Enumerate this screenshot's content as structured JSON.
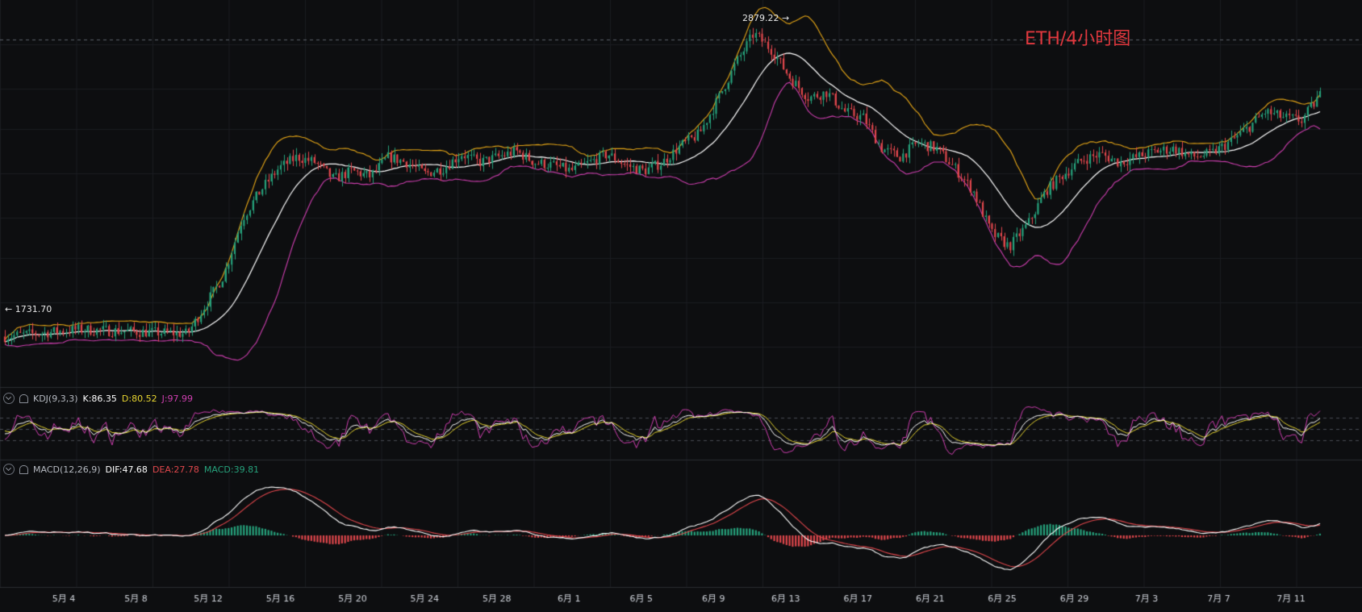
{
  "watermark": "ETH/4小时图",
  "price_markers": {
    "high": "2879.22",
    "low": "1731.70"
  },
  "kdj": {
    "name": "KDJ(9,3,3)",
    "k": "K:86.35",
    "d": "D:80.52",
    "j": "J:97.99"
  },
  "macd": {
    "name": "MACD(12,26,9)",
    "dif": "DIF:47.68",
    "dea": "DEA:27.78",
    "macd": "MACD:39.81"
  },
  "colors": {
    "up": "#26a17b",
    "down": "#e0474c",
    "mid": "#ffffff",
    "upper": "#e8a817",
    "lower": "#cf3fb0",
    "k": "#ffffff",
    "d": "#e8d630",
    "j": "#cf3fb0"
  },
  "chart_data": {
    "type": "candlestick",
    "x_ticks": [
      "5月 4",
      "5月 8",
      "5月 12",
      "5月 16",
      "5月 20",
      "5月 24",
      "5月 28",
      "6月 1",
      "6月 5",
      "6月 9",
      "6月 13",
      "6月 17",
      "6月 21",
      "6月 25",
      "6月 29",
      "7月 3",
      "7月 7",
      "7月 11"
    ],
    "price_path": [
      [
        0,
        1780
      ],
      [
        4,
        1805
      ],
      [
        8,
        1795
      ],
      [
        10,
        1790
      ],
      [
        12,
        2000
      ],
      [
        13,
        2200
      ],
      [
        14,
        2300
      ],
      [
        15,
        2380
      ],
      [
        16,
        2420
      ],
      [
        17,
        2400
      ],
      [
        18,
        2340
      ],
      [
        19,
        2370
      ],
      [
        20,
        2350
      ],
      [
        21,
        2420
      ],
      [
        22,
        2400
      ],
      [
        23,
        2360
      ],
      [
        24,
        2380
      ],
      [
        25,
        2430
      ],
      [
        26,
        2400
      ],
      [
        27,
        2420
      ],
      [
        28,
        2440
      ],
      [
        29,
        2400
      ],
      [
        30,
        2390
      ],
      [
        31,
        2370
      ],
      [
        32,
        2400
      ],
      [
        33,
        2430
      ],
      [
        34,
        2390
      ],
      [
        35,
        2370
      ],
      [
        36,
        2400
      ],
      [
        37,
        2460
      ],
      [
        38,
        2500
      ],
      [
        39,
        2620
      ],
      [
        40,
        2750
      ],
      [
        41,
        2860
      ],
      [
        42,
        2800
      ],
      [
        43,
        2700
      ],
      [
        44,
        2630
      ],
      [
        45,
        2650
      ],
      [
        46,
        2580
      ],
      [
        47,
        2560
      ],
      [
        48,
        2450
      ],
      [
        49,
        2420
      ],
      [
        50,
        2470
      ],
      [
        51,
        2450
      ],
      [
        52,
        2380
      ],
      [
        53,
        2300
      ],
      [
        54,
        2150
      ],
      [
        55,
        2100
      ],
      [
        56,
        2180
      ],
      [
        57,
        2300
      ],
      [
        58,
        2360
      ],
      [
        59,
        2410
      ],
      [
        60,
        2430
      ],
      [
        61,
        2400
      ],
      [
        62,
        2420
      ],
      [
        63,
        2440
      ],
      [
        64,
        2450
      ],
      [
        65,
        2420
      ],
      [
        66,
        2430
      ],
      [
        67,
        2470
      ],
      [
        68,
        2520
      ],
      [
        69,
        2580
      ],
      [
        70,
        2560
      ],
      [
        71,
        2550
      ],
      [
        72,
        2640
      ]
    ]
  }
}
